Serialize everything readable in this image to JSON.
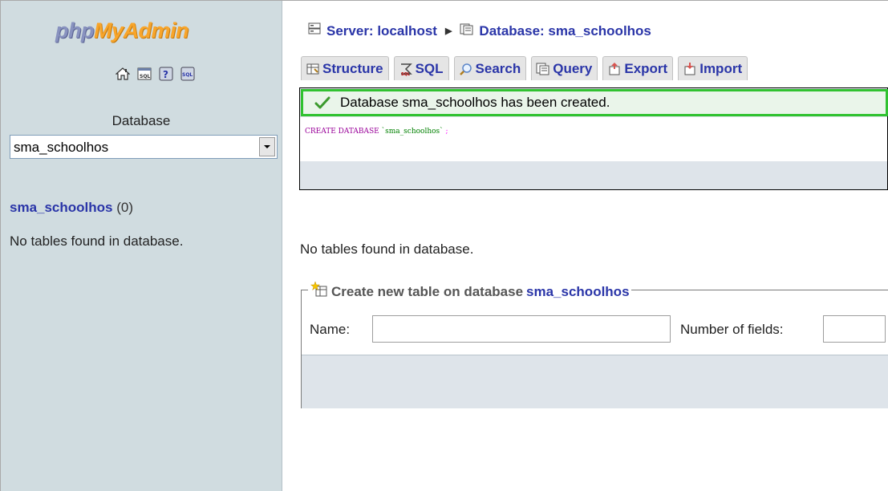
{
  "logo": {
    "part1": "php",
    "part2": "My",
    "part3": "Admin"
  },
  "nav_icons": [
    "home-icon",
    "sql-query-icon",
    "help-icon",
    "sql-docs-icon"
  ],
  "left": {
    "db_label": "Database",
    "db_select_value": "sma_schoolhos",
    "db_name": "sma_schoolhos",
    "db_count": "(0)",
    "no_tables": "No tables found in database."
  },
  "breadcrumb": {
    "server": "Server: localhost",
    "database": "Database: sma_schoolhos"
  },
  "tabs": [
    {
      "label": "Structure",
      "icon": "structure-icon"
    },
    {
      "label": "SQL",
      "icon": "sql-icon"
    },
    {
      "label": "Search",
      "icon": "search-icon"
    },
    {
      "label": "Query",
      "icon": "query-icon"
    },
    {
      "label": "Export",
      "icon": "export-icon"
    },
    {
      "label": "Import",
      "icon": "import-icon"
    }
  ],
  "message": {
    "success": "Database sma_schoolhos has been created.",
    "sql_keyword": "CREATE DATABASE",
    "sql_string": "`sma_schoolhos`",
    "sql_end": ";"
  },
  "main": {
    "no_tables": "No tables found in database."
  },
  "create_table": {
    "legend_prefix": "Create new table on database",
    "legend_db": "sma_schoolhos",
    "name_label": "Name:",
    "name_value": "",
    "fields_label": "Number of fields:",
    "fields_value": ""
  },
  "colors": {
    "link": "#2a35a8",
    "nav_bg": "#d0dce0",
    "success_border": "#30c230"
  }
}
